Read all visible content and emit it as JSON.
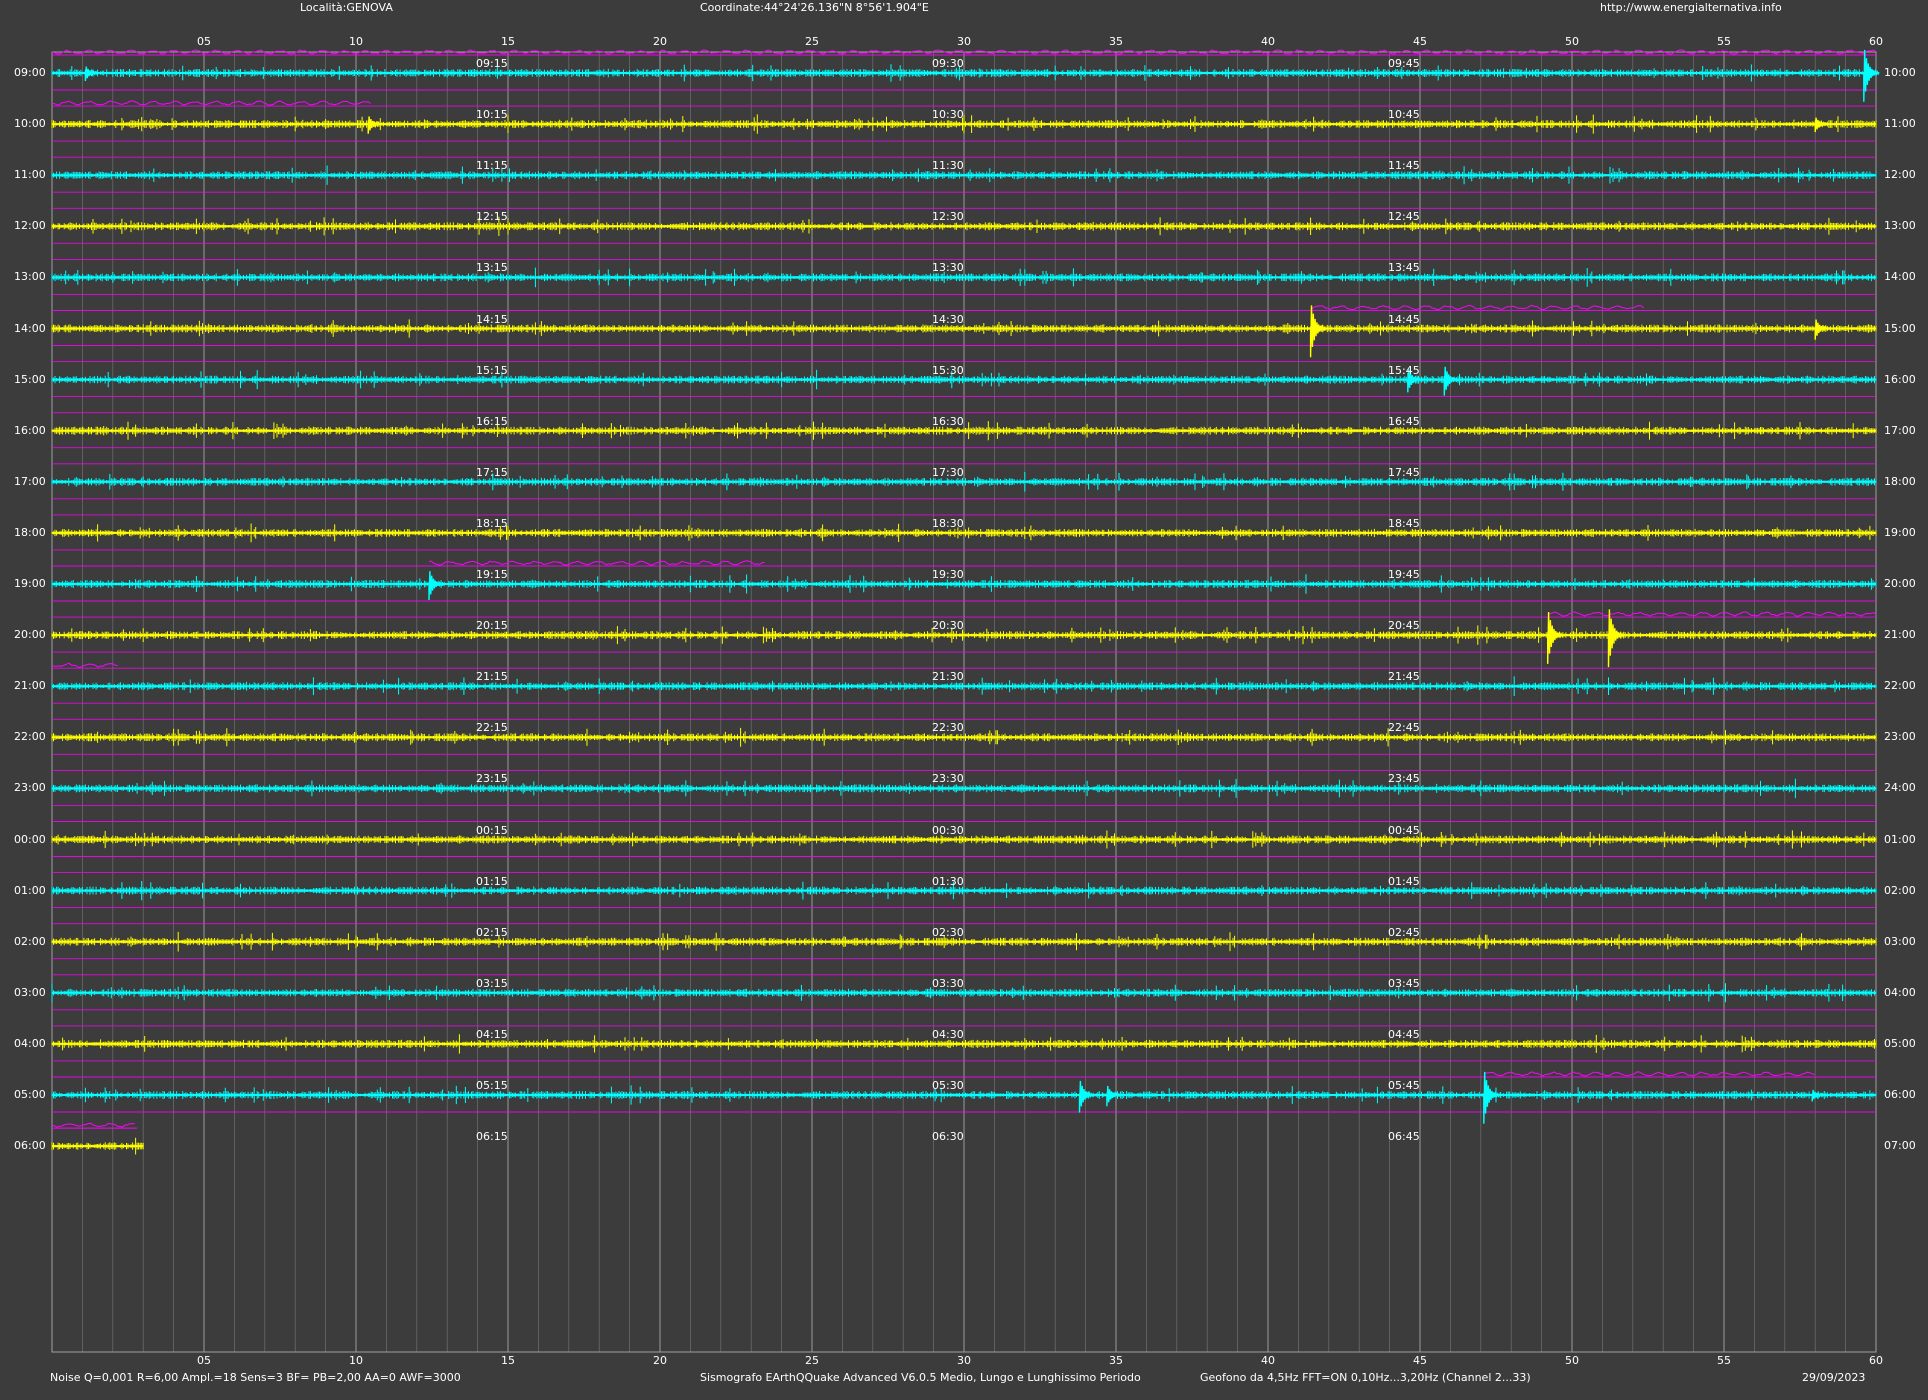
{
  "header": {
    "location": "Località:GENOVA",
    "coordinates": "Coordinate:44°24'26.136\"N  8°56'1.904\"E",
    "website": "http://www.energialternativa.info"
  },
  "footer": {
    "params": "Noise Q=0,001 R=6,00 Ampl.=18 Sens=3 BF= PB=2,00 AA=0 AWF=3000",
    "software": "Sismografo  EArthQQuake Advanced V6.0.5  Medio, Lungo e Lunghissimo Periodo",
    "sensor": "Geofono da 4,5Hz FFT=ON 0,10Hz...3,20Hz      (Channel 2...33)",
    "date": "29/09/2023"
  },
  "colors": {
    "background": "#3c3c3c",
    "cyan_trace": "#00ffff",
    "yellow_trace": "#ffff00",
    "magenta_trace": "#ff00ff",
    "grid": "#808080",
    "text": "#ffffff"
  },
  "chart_data": {
    "type": "line",
    "title": "",
    "xlabel": "",
    "ylabel": "",
    "xlim": [
      0,
      60
    ],
    "x_ticks": [
      "05",
      "10",
      "15",
      "20",
      "25",
      "30",
      "35",
      "40",
      "45",
      "50",
      "55",
      "60"
    ],
    "grid": true,
    "left_labels": [
      "09:00",
      "10:00",
      "11:00",
      "12:00",
      "13:00",
      "14:00",
      "15:00",
      "16:00",
      "17:00",
      "18:00",
      "19:00",
      "20:00",
      "21:00",
      "22:00",
      "23:00",
      "00:00",
      "01:00",
      "02:00",
      "03:00",
      "04:00",
      "05:00",
      "06:00"
    ],
    "right_labels": [
      "10:00",
      "11:00",
      "12:00",
      "13:00",
      "14:00",
      "15:00",
      "16:00",
      "17:00",
      "18:00",
      "19:00",
      "20:00",
      "21:00",
      "22:00",
      "23:00",
      "24:00",
      "01:00",
      "02:00",
      "03:00",
      "04:00",
      "05:00",
      "06:00",
      "07:00"
    ],
    "quarter_labels": [
      [
        "09:15",
        "09:30",
        "09:45"
      ],
      [
        "10:15",
        "10:30",
        "10:45"
      ],
      [
        "11:15",
        "11:30",
        "11:45"
      ],
      [
        "12:15",
        "12:30",
        "12:45"
      ],
      [
        "13:15",
        "13:30",
        "13:45"
      ],
      [
        "14:15",
        "14:30",
        "14:45"
      ],
      [
        "15:15",
        "15:30",
        "15:45"
      ],
      [
        "16:15",
        "16:30",
        "16:45"
      ],
      [
        "17:15",
        "17:30",
        "17:45"
      ],
      [
        "18:15",
        "18:30",
        "18:45"
      ],
      [
        "19:15",
        "19:30",
        "19:45"
      ],
      [
        "20:15",
        "20:30",
        "20:45"
      ],
      [
        "21:15",
        "21:30",
        "21:45"
      ],
      [
        "22:15",
        "22:30",
        "22:45"
      ],
      [
        "23:15",
        "23:30",
        "23:45"
      ],
      [
        "00:15",
        "00:30",
        "00:45"
      ],
      [
        "01:15",
        "01:30",
        "01:45"
      ],
      [
        "02:15",
        "02:30",
        "02:45"
      ],
      [
        "03:15",
        "03:30",
        "03:45"
      ],
      [
        "04:15",
        "04:30",
        "04:45"
      ],
      [
        "05:15",
        "05:30",
        "05:45"
      ],
      [
        "06:15",
        "06:30",
        "06:45"
      ]
    ],
    "series": [
      {
        "color": "cyan",
        "rows": [
          0,
          2,
          4,
          6,
          8,
          10,
          12,
          14,
          16,
          18,
          20
        ]
      },
      {
        "color": "yellow",
        "rows": [
          1,
          3,
          5,
          7,
          9,
          11,
          13,
          15,
          17,
          19,
          21
        ]
      }
    ],
    "last_row_end_minute": 3,
    "events": [
      {
        "row": 0,
        "minute": 1.1,
        "amp": 0.25
      },
      {
        "row": 0,
        "minute": 59.6,
        "amp": 0.9
      },
      {
        "row": 1,
        "minute": 10.4,
        "amp": 0.3
      },
      {
        "row": 1,
        "minute": 58,
        "amp": 0.25
      },
      {
        "row": 5,
        "minute": 41.4,
        "amp": 0.9
      },
      {
        "row": 5,
        "minute": 58,
        "amp": 0.35
      },
      {
        "row": 6,
        "minute": 44.6,
        "amp": 0.4
      },
      {
        "row": 6,
        "minute": 45.8,
        "amp": 0.5
      },
      {
        "row": 10,
        "minute": 12.4,
        "amp": 0.5
      },
      {
        "row": 11,
        "minute": 49.2,
        "amp": 0.9
      },
      {
        "row": 11,
        "minute": 51.2,
        "amp": 1.0
      },
      {
        "row": 20,
        "minute": 33.8,
        "amp": 0.55
      },
      {
        "row": 20,
        "minute": 34.7,
        "amp": 0.35
      },
      {
        "row": 20,
        "minute": 47.1,
        "amp": 0.9
      },
      {
        "row": 20,
        "minute": 57.9,
        "amp": 0.2
      }
    ],
    "magenta_segments": [
      {
        "row": 0,
        "from": 0,
        "to": 60
      },
      {
        "row": 1,
        "from": 0,
        "to": 10.5
      },
      {
        "row": 5,
        "from": 41.4,
        "to": 52.4
      },
      {
        "row": 10,
        "from": 12.4,
        "to": 23.5
      },
      {
        "row": 11,
        "from": 49.2,
        "to": 60
      },
      {
        "row": 12,
        "from": 0,
        "to": 2.2
      },
      {
        "row": 20,
        "from": 47.1,
        "to": 58
      },
      {
        "row": 21,
        "from": 0,
        "to": 2.8
      }
    ]
  }
}
